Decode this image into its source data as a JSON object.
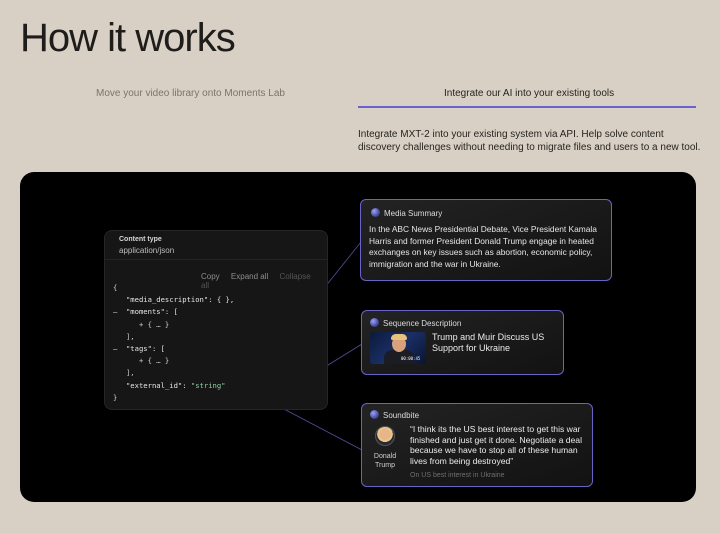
{
  "page": {
    "title": "How it works"
  },
  "tabs": [
    {
      "label": "Move your video library onto Moments Lab",
      "active": false
    },
    {
      "label": "Integrate our AI into your existing tools",
      "active": true
    }
  ],
  "description": "Integrate MXT-2 into your existing system via API. Help solve content discovery challenges without needing to migrate files and users to a new tool.",
  "code_panel": {
    "content_type_label": "Content type",
    "content_type_value": "application/json",
    "actions": {
      "copy": "Copy",
      "expand_all": "Expand all",
      "collapse_all": "Collapse all"
    },
    "lines": [
      "{",
      "   \"media_description\": { },",
      "–  \"moments\": [",
      "      + { … }",
      "   ],",
      "–  \"tags\": [",
      "      + { … }",
      "   ],",
      "   \"external_id\": ",
      "}"
    ],
    "external_id_value": "\"string\""
  },
  "cards": {
    "summary": {
      "icon": "ai-orb-icon",
      "title": "Media Summary",
      "body": "In the ABC News Presidential Debate, Vice President Kamala Harris and former President Donald Trump engage in heated exchanges on key issues such as abortion, economic policy, immigration and the war in Ukraine."
    },
    "sequence": {
      "icon": "ai-orb-icon",
      "title": "Sequence Description",
      "thumbnail_timecode": "00:00:45",
      "body": "Trump and Muir Discuss US Support for Ukraine"
    },
    "soundbite": {
      "icon": "ai-orb-icon",
      "title": "Soundbite",
      "speaker_first": "Donald",
      "speaker_last": "Trump",
      "quote": "“I think its the US best interest to get this war finished and just get it done. Negotiate a deal because we have to stop all of these human lives from being destroyed”",
      "reference": "On US best interest in Ukraine"
    }
  },
  "colors": {
    "background": "#d9d0c5",
    "accent": "#6c5fd3",
    "stage": "#000000"
  }
}
